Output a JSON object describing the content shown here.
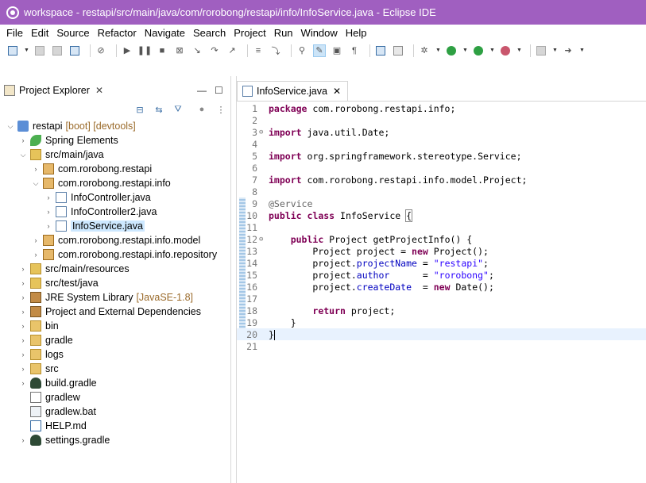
{
  "window": {
    "title": "workspace - restapi/src/main/java/com/rorobong/restapi/info/InfoService.java - Eclipse IDE"
  },
  "menu": [
    "File",
    "Edit",
    "Source",
    "Refactor",
    "Navigate",
    "Search",
    "Project",
    "Run",
    "Window",
    "Help"
  ],
  "explorer": {
    "tab_label": "Project Explorer",
    "minimize": "—",
    "maximize": "☐",
    "tree": [
      {
        "label": "restapi",
        "deco": "[boot] [devtools]",
        "icon": "project-icon"
      },
      {
        "label": "Spring Elements",
        "icon": "spring-leaf-icon"
      },
      {
        "label": "src/main/java",
        "icon": "source-folder-icon"
      },
      {
        "label": "com.rorobong.restapi",
        "icon": "package-icon"
      },
      {
        "label": "com.rorobong.restapi.info",
        "icon": "package-icon"
      },
      {
        "label": "InfoController.java",
        "icon": "java-file-icon"
      },
      {
        "label": "InfoController2.java",
        "icon": "java-file-icon"
      },
      {
        "label": "InfoService.java",
        "icon": "java-file-icon"
      },
      {
        "label": "com.rorobong.restapi.info.model",
        "icon": "package-icon"
      },
      {
        "label": "com.rorobong.restapi.info.repository",
        "icon": "package-icon"
      },
      {
        "label": "src/main/resources",
        "icon": "source-folder-icon"
      },
      {
        "label": "src/test/java",
        "icon": "source-folder-icon"
      },
      {
        "label": "JRE System Library",
        "deco": "[JavaSE-1.8]",
        "icon": "library-icon"
      },
      {
        "label": "Project and External Dependencies",
        "icon": "library-icon"
      },
      {
        "label": "bin",
        "icon": "folder-icon"
      },
      {
        "label": "gradle",
        "icon": "folder-icon"
      },
      {
        "label": "logs",
        "icon": "folder-icon"
      },
      {
        "label": "src",
        "icon": "folder-icon"
      },
      {
        "label": "build.gradle",
        "icon": "gradle-icon"
      },
      {
        "label": "gradlew",
        "icon": "file-icon"
      },
      {
        "label": "gradlew.bat",
        "icon": "bat-file-icon"
      },
      {
        "label": "HELP.md",
        "icon": "markdown-file-icon"
      },
      {
        "label": "settings.gradle",
        "icon": "gradle-icon"
      }
    ]
  },
  "editor": {
    "tab_label": "InfoService.java",
    "lines": [
      {
        "n": "1",
        "tokens": [
          [
            "kw",
            "package"
          ],
          [
            "",
            " com.rorobong.restapi.info;"
          ]
        ]
      },
      {
        "n": "2",
        "tokens": []
      },
      {
        "n": "3",
        "fold": "⊖",
        "tokens": [
          [
            "kw",
            "import"
          ],
          [
            "",
            " java.util.Date;"
          ]
        ]
      },
      {
        "n": "4",
        "tokens": []
      },
      {
        "n": "5",
        "tokens": [
          [
            "kw",
            "import"
          ],
          [
            "",
            " org.springframework.stereotype.Service;"
          ]
        ]
      },
      {
        "n": "6",
        "tokens": []
      },
      {
        "n": "7",
        "tokens": [
          [
            "kw",
            "import"
          ],
          [
            "",
            " com.rorobong.restapi.info.model.Project;"
          ]
        ]
      },
      {
        "n": "8",
        "tokens": []
      },
      {
        "n": "9",
        "tokens": [
          [
            "ann",
            "@Service"
          ]
        ]
      },
      {
        "n": "10",
        "tokens": [
          [
            "kw",
            "public"
          ],
          [
            "",
            " "
          ],
          [
            "kw",
            "class"
          ],
          [
            "",
            " InfoService "
          ],
          [
            "brace",
            "{"
          ]
        ]
      },
      {
        "n": "11",
        "tokens": []
      },
      {
        "n": "12",
        "fold": "⊖",
        "tokens": [
          [
            "",
            "    "
          ],
          [
            "kw",
            "public"
          ],
          [
            "",
            " Project getProjectInfo() {"
          ]
        ]
      },
      {
        "n": "13",
        "tokens": [
          [
            "",
            "        Project project = "
          ],
          [
            "kw",
            "new"
          ],
          [
            "",
            " Project();"
          ]
        ]
      },
      {
        "n": "14",
        "tokens": [
          [
            "",
            "        project."
          ],
          [
            "field",
            "projectName"
          ],
          [
            "",
            " = "
          ],
          [
            "str",
            "\"restapi\""
          ],
          [
            "",
            ";"
          ]
        ]
      },
      {
        "n": "15",
        "tokens": [
          [
            "",
            "        project."
          ],
          [
            "field",
            "author"
          ],
          [
            "",
            "      = "
          ],
          [
            "str",
            "\"rorobong\""
          ],
          [
            "",
            ";"
          ]
        ]
      },
      {
        "n": "16",
        "tokens": [
          [
            "",
            "        project."
          ],
          [
            "field",
            "createDate"
          ],
          [
            "",
            "  = "
          ],
          [
            "kw",
            "new"
          ],
          [
            "",
            " Date();"
          ]
        ]
      },
      {
        "n": "17",
        "tokens": []
      },
      {
        "n": "18",
        "tokens": [
          [
            "",
            "        "
          ],
          [
            "kw",
            "return"
          ],
          [
            "",
            " project;"
          ]
        ]
      },
      {
        "n": "19",
        "tokens": [
          [
            "",
            "    }"
          ]
        ]
      },
      {
        "n": "20",
        "current": true,
        "tokens": [
          [
            "",
            "}"
          ],
          [
            "caret",
            ""
          ]
        ]
      },
      {
        "n": "21",
        "tokens": []
      }
    ]
  },
  "colors": {
    "titlebar": "#a05fc0",
    "keyword": "#7f0055",
    "field": "#0000c0",
    "string": "#2a00ff",
    "annotation": "#646464",
    "selection": "#cde8ff"
  }
}
